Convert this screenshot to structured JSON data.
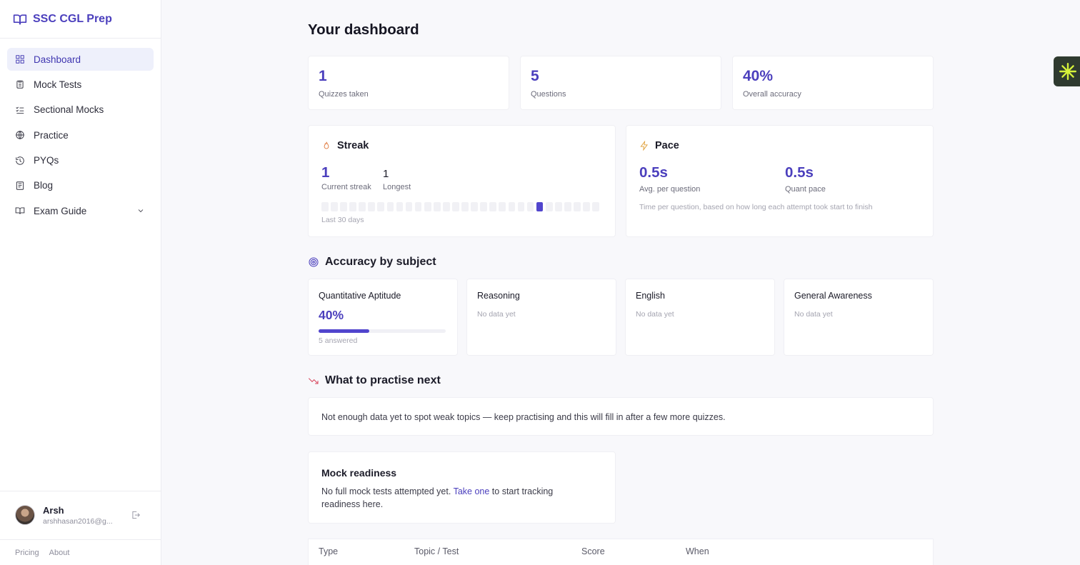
{
  "app": {
    "name": "SSC CGL Prep",
    "logo_icon": "book-open-icon",
    "accent": "#4b3fbd"
  },
  "sidebar": {
    "items": [
      {
        "label": "Dashboard",
        "icon": "grid-icon",
        "active": true
      },
      {
        "label": "Mock Tests",
        "icon": "clipboard-icon"
      },
      {
        "label": "Sectional Mocks",
        "icon": "list-check-icon"
      },
      {
        "label": "Practice",
        "icon": "globe-icon"
      },
      {
        "label": "PYQs",
        "icon": "history-icon"
      },
      {
        "label": "Blog",
        "icon": "newspaper-icon"
      },
      {
        "label": "Exam Guide",
        "icon": "book-icon",
        "expandable": true
      }
    ],
    "user": {
      "name": "Arsh",
      "email": "arshhasan2016@g..."
    },
    "footer_links": [
      "Pricing",
      "About"
    ]
  },
  "main": {
    "title": "Your dashboard",
    "stats": [
      {
        "value": "1",
        "label": "Quizzes taken"
      },
      {
        "value": "5",
        "label": "Questions"
      },
      {
        "value": "40%",
        "label": "Overall accuracy"
      }
    ],
    "streak": {
      "title": "Streak",
      "current": "1",
      "current_label": "Current streak",
      "longest": "1",
      "longest_label": "Longest",
      "footer": "Last 30 days",
      "days_total": 30,
      "active_day_index": 23
    },
    "pace": {
      "title": "Pace",
      "avg": "0.5s",
      "avg_label": "Avg. per question",
      "quant": "0.5s",
      "quant_label": "Quant pace",
      "note": "Time per question, based on how long each attempt took start to finish"
    },
    "accuracy": {
      "title": "Accuracy by subject",
      "subjects": [
        {
          "name": "Quantitative Aptitude",
          "pct": "40%",
          "fraction": 0.4,
          "answered": "5 answered"
        },
        {
          "name": "Reasoning",
          "empty": "No data yet"
        },
        {
          "name": "English",
          "empty": "No data yet"
        },
        {
          "name": "General Awareness",
          "empty": "No data yet"
        }
      ]
    },
    "practise_next": {
      "title": "What to practise next",
      "message": "Not enough data yet to spot weak topics — keep practising and this will fill in after a few more quizzes."
    },
    "mock_readiness": {
      "title": "Mock readiness",
      "text_before": "No full mock tests attempted yet.",
      "link": "Take one",
      "text_after": "to start tracking",
      "text_line2": "readiness here."
    },
    "history_table": {
      "columns": [
        "Type",
        "Topic / Test",
        "Score",
        "When"
      ]
    }
  }
}
